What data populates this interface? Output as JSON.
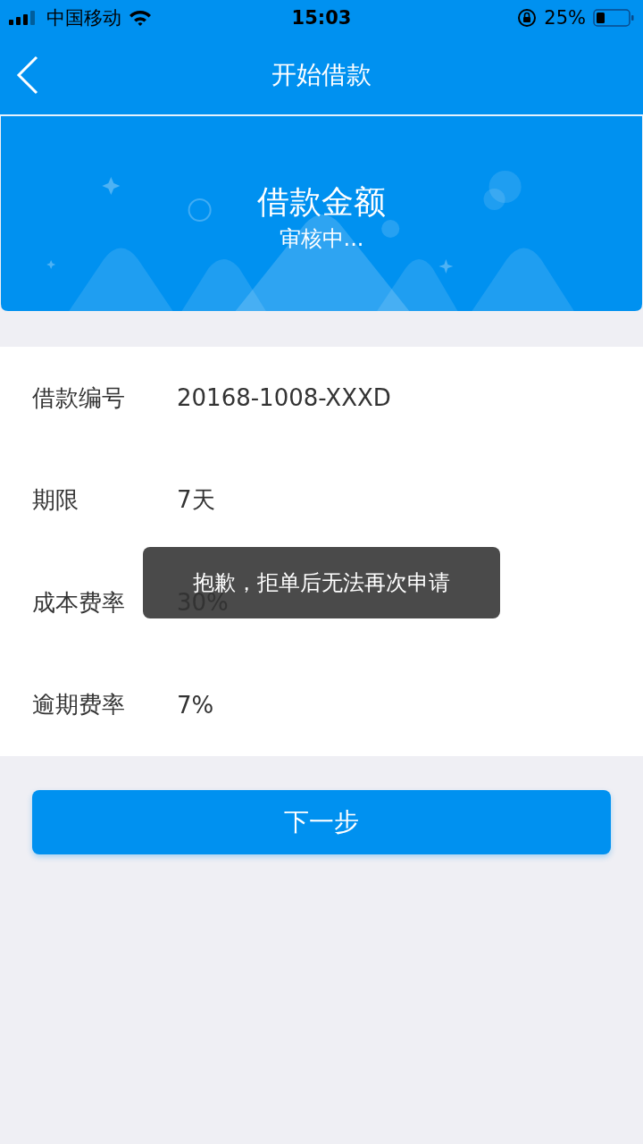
{
  "status_bar": {
    "carrier": "中国移动",
    "time": "15:03",
    "battery": "25%"
  },
  "nav": {
    "title": "开始借款"
  },
  "banner": {
    "title": "借款金额",
    "status": "审核中..."
  },
  "details": [
    {
      "label": "借款编号",
      "value": "20168-1008-XXXD"
    },
    {
      "label": "期限",
      "value": "7天"
    },
    {
      "label": "成本费率",
      "value": "30%"
    },
    {
      "label": "逾期费率",
      "value": "7%"
    }
  ],
  "toast": "抱歉，拒单后无法再次申请",
  "next_button": "下一步"
}
